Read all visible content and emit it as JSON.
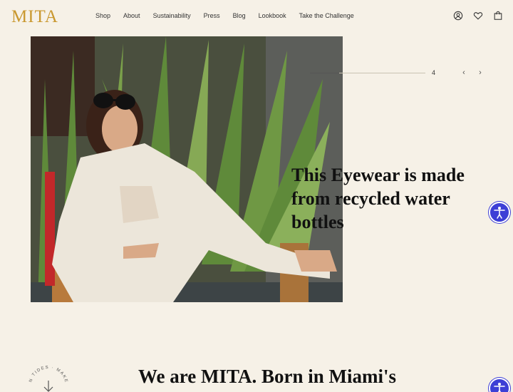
{
  "brand": {
    "logo_text": "MITA",
    "logo_color": "#c9982f"
  },
  "nav": {
    "items": [
      {
        "label": "Shop"
      },
      {
        "label": "About"
      },
      {
        "label": "Sustainability"
      },
      {
        "label": "Press"
      },
      {
        "label": "Blog"
      },
      {
        "label": "Lookbook"
      },
      {
        "label": "Take the Challenge"
      }
    ]
  },
  "header_icons": [
    "account-icon",
    "heart-icon",
    "cart-icon"
  ],
  "hero": {
    "headline": "This Eyewear is made from recycled water bottles",
    "slide_number": "4",
    "slide_progress": 0.25
  },
  "about": {
    "heading": "We are MITA. Born in Miami's",
    "badge_text": "N TIDES · MAKE"
  },
  "colors": {
    "background": "#f6f1e7",
    "accessibility": "#3d3fd6"
  }
}
